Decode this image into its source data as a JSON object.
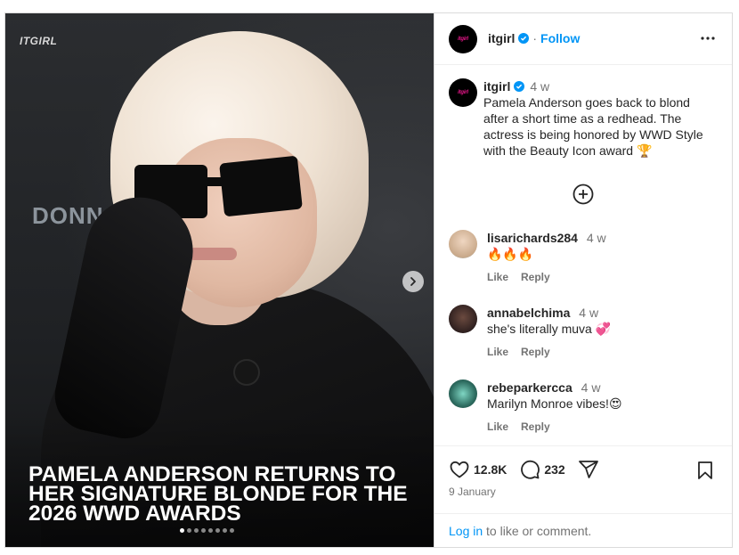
{
  "media": {
    "watermark": "ITGIRL",
    "background_text": "DONN",
    "headline": "PAMELA ANDERSON RETURNS TO HER SIGNATURE BLONDE FOR THE 2026 WWD AWARDS",
    "carousel": {
      "count": 8,
      "active_index": 0
    }
  },
  "header": {
    "avatar_text": "itgirl",
    "username": "itgirl",
    "separator": "·",
    "follow_label": "Follow"
  },
  "caption": {
    "username": "itgirl",
    "time": "4 w",
    "text": "Pamela Anderson goes back to blond after a short time as a redhead. The actress is being honored by WWD Style with the Beauty Icon award 🏆"
  },
  "comments": [
    {
      "username": "lisarichards284",
      "time": "4 w",
      "text": "🔥🔥🔥",
      "like_label": "Like",
      "reply_label": "Reply",
      "avatar_color": "#c9a98a"
    },
    {
      "username": "annabelchima",
      "time": "4 w",
      "text": "she's literally muva 💞",
      "like_label": "Like",
      "reply_label": "Reply",
      "avatar_color": "#3b2a2a"
    },
    {
      "username": "rebeparkercca",
      "time": "4 w",
      "text": "Marilyn Monroe vibes!😍",
      "like_label": "Like",
      "reply_label": "Reply",
      "avatar_color": "#2f6e62"
    }
  ],
  "actions": {
    "likes": "12.8K",
    "comments": "232",
    "date": "9 January"
  },
  "login": {
    "link_label": "Log in",
    "rest": "to like or comment."
  },
  "colors": {
    "accent": "#0095f6",
    "verified": "#0095f6",
    "muted": "#737373"
  },
  "icons": [
    "verified-badge-icon",
    "more-options-icon",
    "add-circle-icon",
    "heart-icon",
    "comment-icon",
    "share-icon",
    "bookmark-icon",
    "chevron-right-icon"
  ]
}
